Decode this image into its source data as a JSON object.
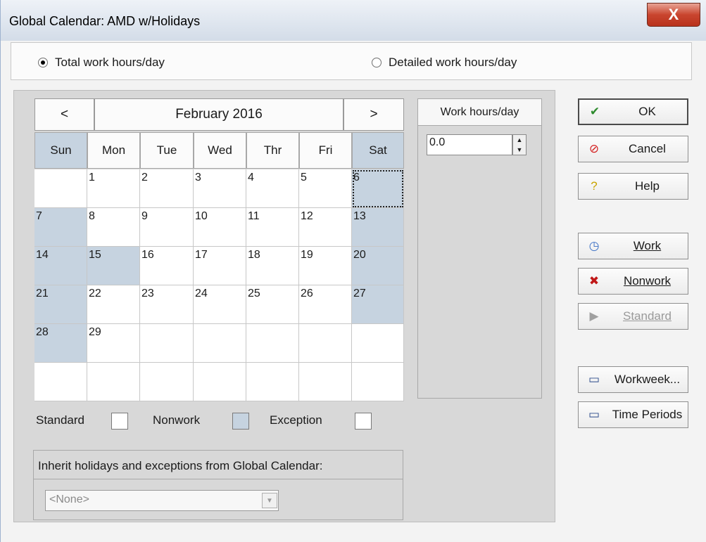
{
  "window": {
    "title": "Global Calendar: AMD w/Holidays",
    "close_label": "X"
  },
  "mode": {
    "options": [
      {
        "label": "Total work hours/day",
        "selected": true
      },
      {
        "label": "Detailed work hours/day",
        "selected": false
      }
    ]
  },
  "calendar": {
    "prev_label": "<",
    "next_label": ">",
    "month_label": "February 2016",
    "weekdays": [
      "Sun",
      "Mon",
      "Tue",
      "Wed",
      "Thr",
      "Fri",
      "Sat"
    ],
    "weeks": [
      [
        "",
        "1",
        "2",
        "3",
        "4",
        "5",
        "6"
      ],
      [
        "7",
        "8",
        "9",
        "10",
        "11",
        "12",
        "13"
      ],
      [
        "14",
        "15",
        "16",
        "17",
        "18",
        "19",
        "20"
      ],
      [
        "21",
        "22",
        "23",
        "24",
        "25",
        "26",
        "27"
      ],
      [
        "28",
        "29",
        "",
        "",
        "",
        "",
        ""
      ],
      [
        "",
        "",
        "",
        "",
        "",
        "",
        ""
      ]
    ],
    "nonwork_days": [
      "6",
      "7",
      "13",
      "14",
      "15",
      "20",
      "21",
      "27",
      "28"
    ],
    "selected_day": "6",
    "colors": {
      "nonwork": "#c6d3e0",
      "standard": "#ffffff",
      "exception": "#ffffff"
    }
  },
  "work_hours": {
    "header": "Work hours/day",
    "value": "0.0"
  },
  "legend": {
    "standard": "Standard",
    "nonwork": "Nonwork",
    "exception": "Exception"
  },
  "inherit": {
    "label": "Inherit holidays and exceptions from Global Calendar:",
    "value": "<None>"
  },
  "buttons": {
    "ok": "OK",
    "cancel": "Cancel",
    "help": "Help",
    "work": "Work",
    "nonwork": "Nonwork",
    "standard": "Standard",
    "workweek": "Workweek...",
    "time_periods": "Time Periods"
  }
}
